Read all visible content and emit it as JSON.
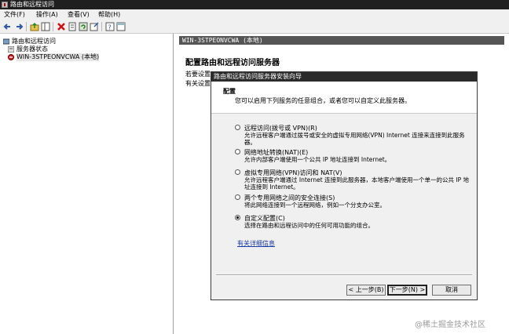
{
  "window": {
    "title": "路由和远程访问"
  },
  "menu": [
    {
      "label": "文件(F)"
    },
    {
      "label": "操作(A)"
    },
    {
      "label": "查看(V)"
    },
    {
      "label": "帮助(H)"
    }
  ],
  "toolbar": {
    "icons": [
      "back-arrow-icon",
      "forward-arrow-icon",
      "up-folder-icon",
      "show-tree-icon",
      "delete-icon",
      "properties-icon",
      "refresh-icon",
      "export-icon",
      "help-icon",
      "pane-icon"
    ]
  },
  "tree": {
    "root": "路由和远程访问",
    "server_status": "服务器状态",
    "server": "WIN-3STPEONVCWA (本地)"
  },
  "main": {
    "header": "WIN-3STPEONVCWA (本地)",
    "title": "配置路由和远程访问服务器",
    "desc1": "若要设置",
    "desc2": "有关设置"
  },
  "dialog": {
    "title": "路由和远程访问服务器安装向导",
    "heading": "配置",
    "subheading": "您可以启用下列服务的任意组合，或者您可以自定义此服务器。",
    "options": [
      {
        "label": "远程访问(拨号或 VPN)(R)",
        "desc": "允许远程客户端通过拨号或安全的虚拟专用网络(VPN) Internet 连接来连接到此服务器。",
        "selected": false
      },
      {
        "label": "网络地址转换(NAT)(E)",
        "desc": "允许内部客户端使用一个公共 IP 地址连接到 Internet。",
        "selected": false
      },
      {
        "label": "虚拟专用网络(VPN)访问和 NAT(V)",
        "desc": "允许远程客户端通过 Internet 连接到此服务器，本地客户端使用一个单一的公共 IP 地址连接到 Internet。",
        "selected": false
      },
      {
        "label": "两个专用网络之间的安全连接(S)",
        "desc": "将此网络连接到一个远程网络，例如一个分支办公室。",
        "selected": false
      },
      {
        "label": "自定义配置(C)",
        "desc": "选择在路由和远程访问中的任何可用功能的组合。",
        "selected": true
      }
    ],
    "more_link": "有关详细信息",
    "buttons": {
      "back": "< 上一步(B)",
      "next": "下一步(N) >",
      "cancel": "取消"
    }
  },
  "watermark": "@稀土掘金技术社区"
}
